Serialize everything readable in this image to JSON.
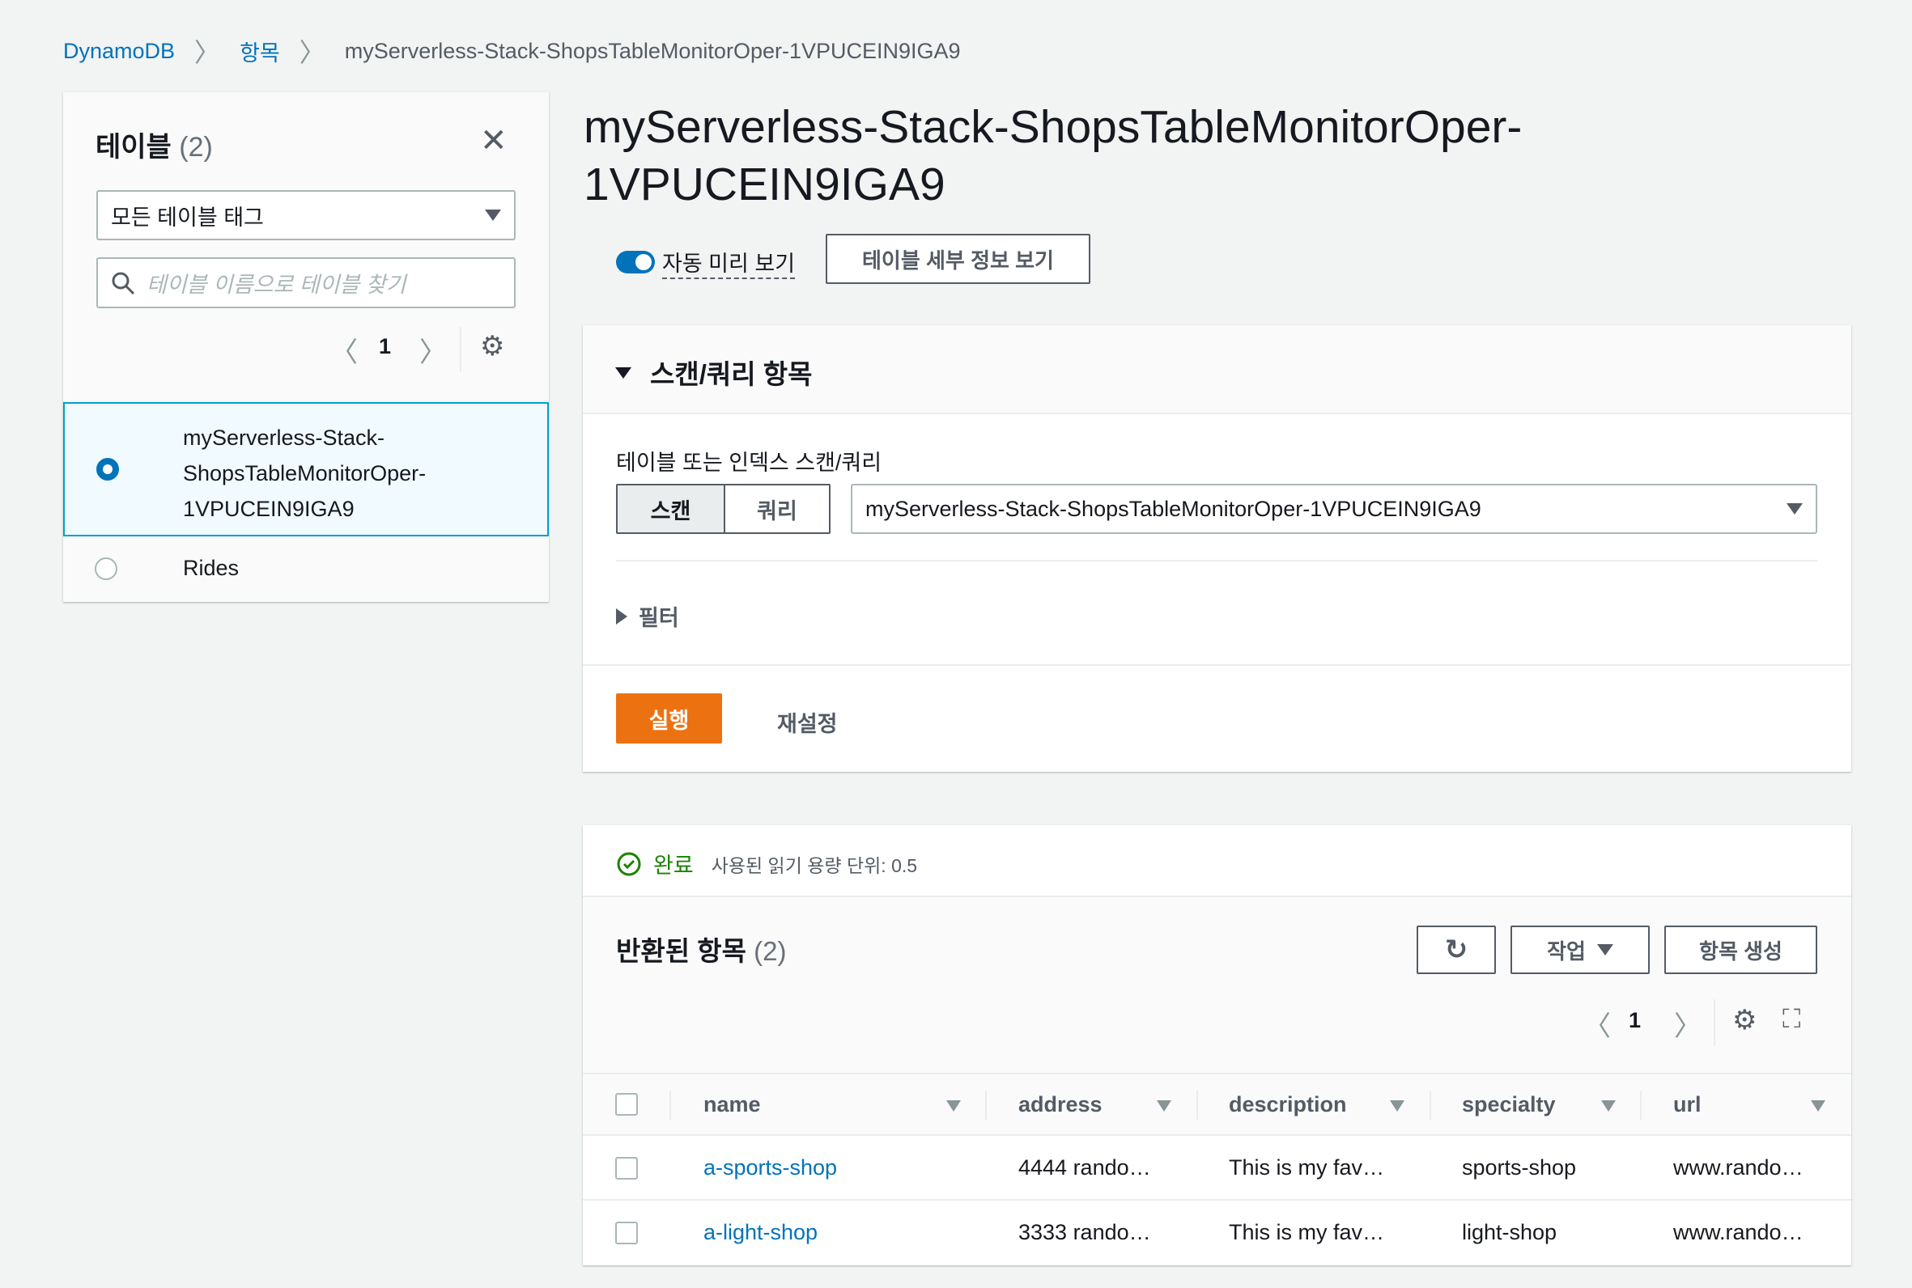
{
  "breadcrumb": {
    "items": [
      "DynamoDB",
      "항목"
    ],
    "current": "myServerless-Stack-ShopsTableMonitorOper-1VPUCEIN9IGA9"
  },
  "sidebar": {
    "title": "테이블",
    "count": "(2)",
    "tag_filter": "모든 테이블 태그",
    "search_placeholder": "테이블 이름으로 테이블 찾기",
    "page": "1",
    "tables": [
      {
        "name_lines": [
          "myServerless-Stack-",
          "ShopsTableMonitorOper-",
          "1VPUCEIN9IGA9"
        ],
        "selected": true
      },
      {
        "name_lines": [
          "Rides"
        ],
        "selected": false
      }
    ]
  },
  "main": {
    "title_line1": "myServerless-Stack-ShopsTableMonitorOper-",
    "title_line2": "1VPUCEIN9IGA9",
    "auto_preview_label": "자동 미리 보기",
    "auto_preview_on": true,
    "details_button": "테이블 세부 정보 보기"
  },
  "scan": {
    "header": "스캔/쿼리 항목",
    "label": "테이블 또는 인덱스 스캔/쿼리",
    "seg_scan": "스캔",
    "seg_query": "쿼리",
    "selected_table": "myServerless-Stack-ShopsTableMonitorOper-1VPUCEIN9IGA9",
    "filter": "필터",
    "run": "실행",
    "reset": "재설정"
  },
  "results": {
    "status": "완료",
    "consumed": "사용된 읽기 용량 단위: 0.5",
    "title": "반환된 항목",
    "count": "(2)",
    "actions": "작업",
    "create": "항목 생성",
    "page": "1",
    "columns": [
      "name",
      "address",
      "description",
      "specialty",
      "url"
    ],
    "rows": [
      [
        "a-sports-shop",
        "4444 rando…",
        "This is my fav…",
        "sports-shop",
        "www.rando…"
      ],
      [
        "a-light-shop",
        "3333 rando…",
        "This is my fav…",
        "light-shop",
        "www.rando…"
      ]
    ]
  },
  "colors": {
    "accent": "#0073bb",
    "primary": "#ec7211",
    "success": "#1d8102"
  }
}
